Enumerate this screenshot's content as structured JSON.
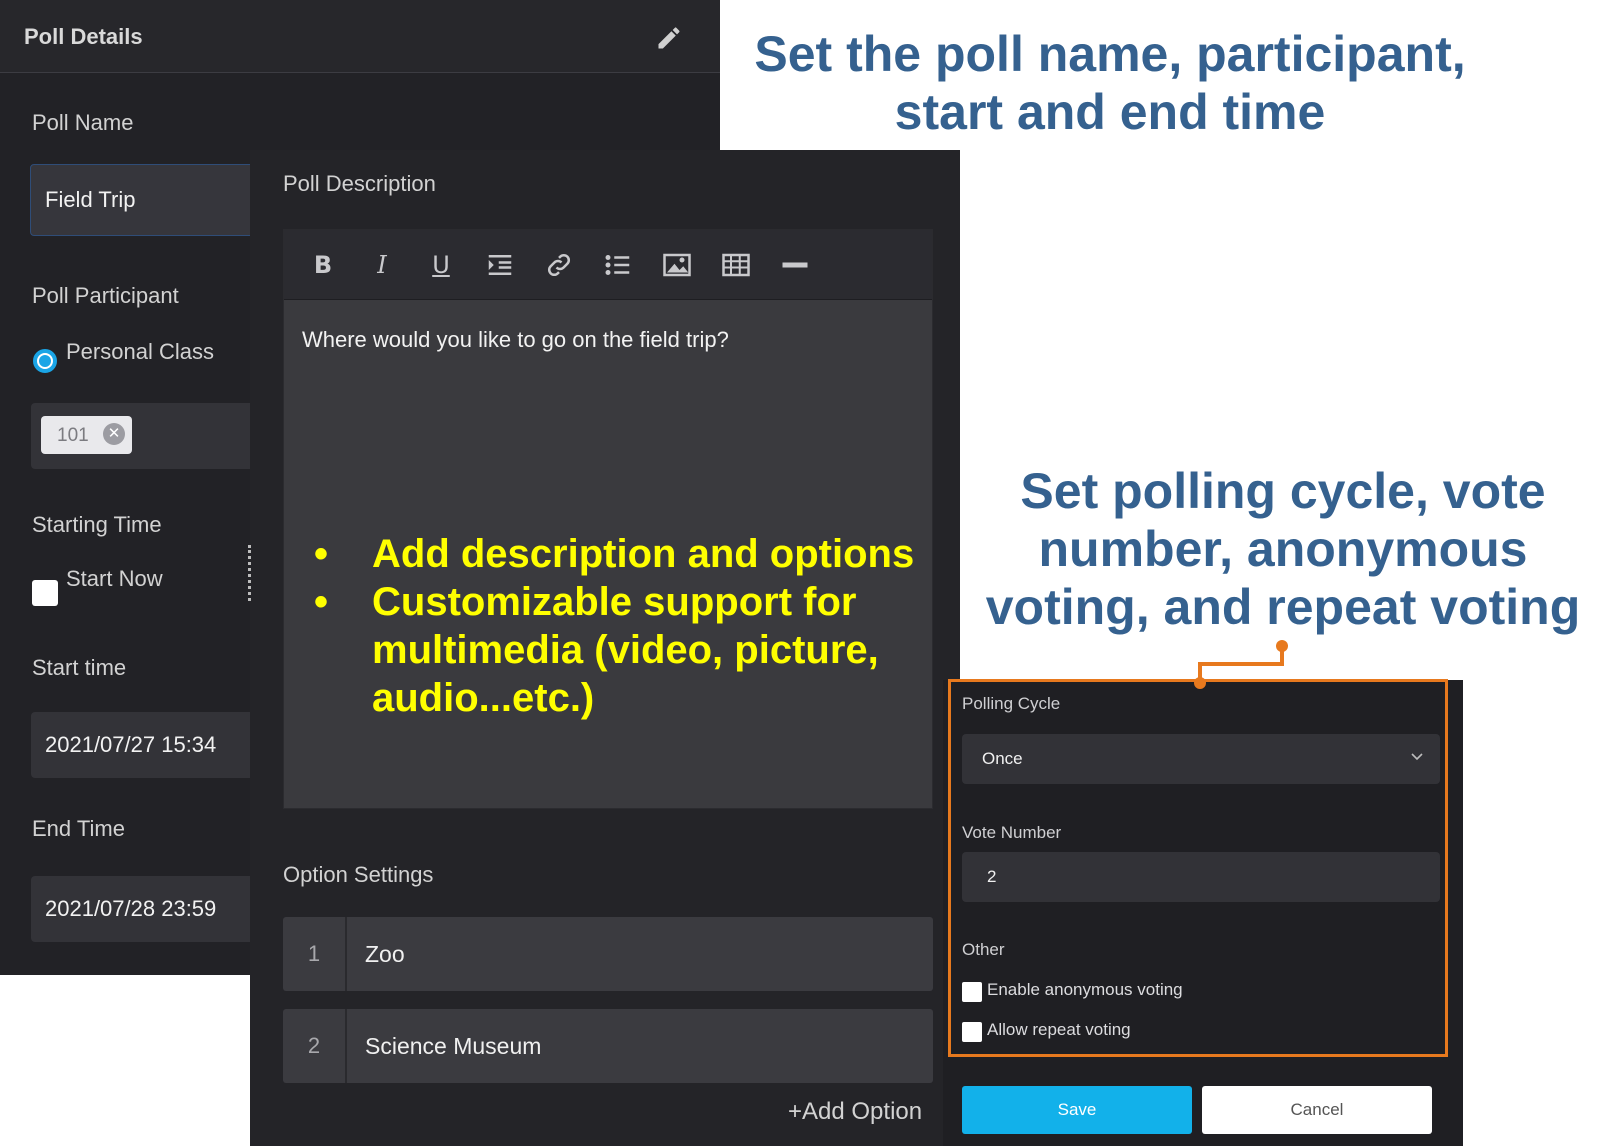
{
  "colors": {
    "accent_blue": "#1aa5e6",
    "save_blue": "#12b1ea",
    "annotation_blue": "#35618f",
    "highlight_yellow": "#ffff00",
    "frame_orange": "#e7791e",
    "panel_dark": "#222226"
  },
  "poll_details": {
    "title": "Poll Details",
    "edit_icon": "pencil-icon",
    "poll_name_label": "Poll Name",
    "poll_name_value": "Field Trip",
    "participant_label": "Poll Participant",
    "participant_option": "Personal Class",
    "participant_selected": true,
    "class_chip": "101",
    "starting_time_label": "Starting Time",
    "start_now_label": "Start Now",
    "start_now_checked": false,
    "start_time_label": "Start time",
    "start_time_value": "2021/07/27 15:34",
    "end_time_label": "End Time",
    "end_time_value": "2021/07/28 23:59"
  },
  "description": {
    "label": "Poll Description",
    "toolbar": [
      "bold-icon",
      "italic-icon",
      "underline-icon",
      "indent-icon",
      "link-icon",
      "bullet-list-icon",
      "image-icon",
      "table-icon",
      "horizontal-rule-icon"
    ],
    "text": "Where would you like to go on the field trip?"
  },
  "overlay_bullets": [
    "Add description and options",
    "Customizable support for multimedia (video, picture, audio...etc.)"
  ],
  "options": {
    "label": "Option Settings",
    "items": [
      {
        "num": "1",
        "text": "Zoo"
      },
      {
        "num": "2",
        "text": "Science Museum"
      }
    ],
    "add_label": "+Add Option"
  },
  "settings": {
    "polling_cycle_label": "Polling Cycle",
    "polling_cycle_value": "Once",
    "vote_number_label": "Vote Number",
    "vote_number_value": "2",
    "other_label": "Other",
    "anonymous_label": "Enable anonymous voting",
    "anonymous_checked": false,
    "repeat_label": "Allow repeat voting",
    "repeat_checked": false,
    "save_label": "Save",
    "cancel_label": "Cancel"
  },
  "annotations": {
    "top": "Set the poll name, participant, start and end time",
    "right": "Set polling cycle, vote number, anonymous voting, and repeat voting"
  }
}
